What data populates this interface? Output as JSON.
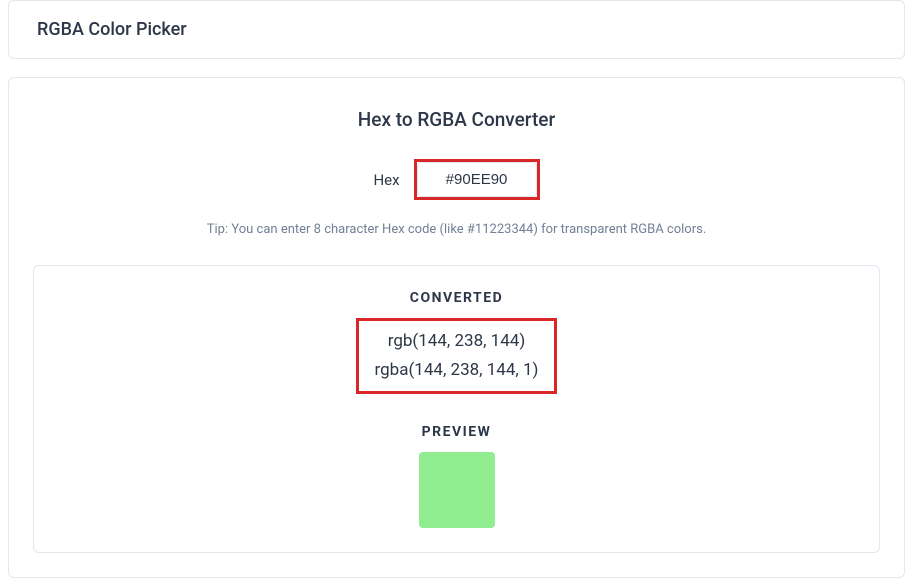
{
  "header": {
    "title": "RGBA Color Picker"
  },
  "main": {
    "title": "Hex to RGBA Converter",
    "hex_label": "Hex",
    "hex_value": "#90EE90",
    "tip": "Tip: You can enter 8 character Hex code (like #11223344) for transparent RGBA colors."
  },
  "result": {
    "converted_heading": "CONVERTED",
    "rgb": "rgb(144, 238, 144)",
    "rgba": "rgba(144, 238, 144, 1)",
    "preview_heading": "PREVIEW",
    "preview_color": "#90EE90"
  },
  "highlight_color": "#d92626"
}
